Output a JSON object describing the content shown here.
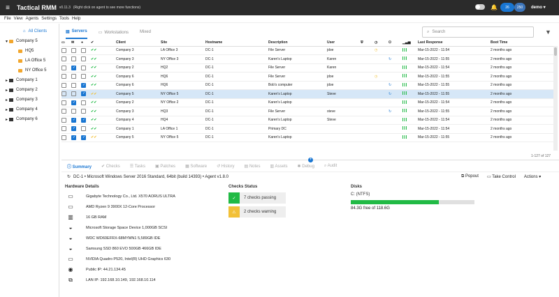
{
  "app": {
    "title": "Tactical RMM",
    "version": "v0.11.3",
    "subtitle": "(Right click on agent to see more functions)",
    "user": "demo"
  },
  "topbar": {
    "agents_online": "26",
    "agents_total": "250",
    "menu_icon": "hamburger-icon"
  },
  "menu": [
    "File",
    "View",
    "Agents",
    "Settings",
    "Tools",
    "Help"
  ],
  "sidebar": {
    "all_clients": "All Clients",
    "tree": [
      {
        "label": "Company 5",
        "type": "client",
        "expanded": true
      },
      {
        "label": "HQ5",
        "type": "site"
      },
      {
        "label": "LA Office 5",
        "type": "site"
      },
      {
        "label": "NY Office 5",
        "type": "site"
      },
      {
        "label": "Company 1",
        "type": "client"
      },
      {
        "label": "Company 2",
        "type": "client"
      },
      {
        "label": "Company 3",
        "type": "client"
      },
      {
        "label": "Company 4",
        "type": "client"
      },
      {
        "label": "Company 6",
        "type": "client"
      }
    ]
  },
  "tabs": {
    "servers": "Servers",
    "workstations": "Workstations",
    "mixed": "Mixed"
  },
  "search": {
    "placeholder": "Search"
  },
  "table": {
    "headers": [
      "Client",
      "Site",
      "Hostname",
      "Description",
      "User",
      "Last Response",
      "Boot Time"
    ],
    "rows": [
      {
        "client": "Company 3",
        "site": "LA Office 3",
        "host": "DC-1",
        "desc": "File Server",
        "user": "jdoe",
        "resp": "Mar-15-2022 - 11:54",
        "boot": "2 months ago",
        "c1": false,
        "c2": false,
        "clock": true,
        "reboot": false,
        "chk": "ok",
        "sel": false
      },
      {
        "client": "Company 3",
        "site": "NY Office 3",
        "host": "DC-1",
        "desc": "Karen's Laptop",
        "user": "Karen",
        "resp": "Mar-15-2022 - 11:55",
        "boot": "2 months ago",
        "c1": false,
        "c2": false,
        "clock": false,
        "reboot": true,
        "chk": "ok",
        "sel": false
      },
      {
        "client": "Company 2",
        "site": "HQ2",
        "host": "DC-1",
        "desc": "File Server",
        "user": "Karen",
        "resp": "Mar-15-2022 - 11:54",
        "boot": "2 months ago",
        "c1": true,
        "c2": false,
        "clock": false,
        "reboot": false,
        "chk": "ok",
        "sel": false
      },
      {
        "client": "Company 6",
        "site": "HQ6",
        "host": "DC-1",
        "desc": "File Server",
        "user": "jdoe",
        "resp": "Mar-15-2022 - 11:55",
        "boot": "2 months ago",
        "c1": false,
        "c2": false,
        "clock": true,
        "reboot": false,
        "chk": "ok",
        "sel": false
      },
      {
        "client": "Company 6",
        "site": "HQ6",
        "host": "DC-1",
        "desc": "Bob's computer",
        "user": "jdoe",
        "resp": "Mar-15-2022 - 11:55",
        "boot": "2 months ago",
        "c1": false,
        "c2": true,
        "clock": false,
        "reboot": true,
        "chk": "ok",
        "sel": false
      },
      {
        "client": "Company 5",
        "site": "NY Office 5",
        "host": "DC-1",
        "desc": "Karen's Laptop",
        "user": "Steve",
        "resp": "Mar-15-2022 - 11:55",
        "boot": "2 months ago",
        "c1": false,
        "c2": true,
        "clock": false,
        "reboot": true,
        "chk": "warn",
        "sel": true
      },
      {
        "client": "Company 2",
        "site": "NY Office 2",
        "host": "DC-1",
        "desc": "Karen's Laptop",
        "user": "",
        "resp": "Mar-15-2022 - 11:54",
        "boot": "2 months ago",
        "c1": true,
        "c2": false,
        "clock": false,
        "reboot": false,
        "chk": "ok",
        "sel": false
      },
      {
        "client": "Company 3",
        "site": "HQ3",
        "host": "DC-1",
        "desc": "File Server",
        "user": "steve",
        "resp": "Mar-15-2022 - 11:55",
        "boot": "2 months ago",
        "c1": false,
        "c2": false,
        "clock": false,
        "reboot": true,
        "chk": "ok",
        "sel": false
      },
      {
        "client": "Company 4",
        "site": "HQ4",
        "host": "DC-1",
        "desc": "Karen's Laptop",
        "user": "Steve",
        "resp": "Mar-15-2022 - 11:54",
        "boot": "2 months ago",
        "c1": true,
        "c2": true,
        "clock": false,
        "reboot": false,
        "chk": "ok",
        "sel": false
      },
      {
        "client": "Company 1",
        "site": "LA Office 1",
        "host": "DC-1",
        "desc": "Primary DC",
        "user": "",
        "resp": "Mar-15-2022 - 11:54",
        "boot": "2 months ago",
        "c1": true,
        "c2": false,
        "clock": false,
        "reboot": false,
        "chk": "ok",
        "sel": false
      },
      {
        "client": "Company 5",
        "site": "NY Office 5",
        "host": "DC-1",
        "desc": "Karen's Laptop",
        "user": "",
        "resp": "Mar-15-2022 - 11:55",
        "boot": "2 months ago",
        "c1": true,
        "c2": true,
        "clock": false,
        "reboot": false,
        "chk": "warn",
        "sel": false
      }
    ],
    "count": "1-127 of 127"
  },
  "bottom_tabs": [
    "Summary",
    "Checks",
    "Tasks",
    "Patches",
    "Software",
    "History",
    "Notes",
    "Assets",
    "Debug",
    "Audit"
  ],
  "agent_line": "DC-1 • Microsoft Windows Server 2016 Standard, 64bit (build 14393) • Agent v1.8.0",
  "actions": {
    "popout": "Popout",
    "take_control": "Take Control",
    "actions": "Actions"
  },
  "hardware": {
    "title": "Hardware Details",
    "items": [
      {
        "icon": "motherboard-icon",
        "text": "Gigabyte Technology Co., Ltd. X570 AORUS ULTRA"
      },
      {
        "icon": "cpu-icon",
        "text": "AMD Ryzen 9 3900X 12-Core Processor"
      },
      {
        "icon": "memory-icon",
        "text": "16 GB RAM"
      },
      {
        "icon": "disk-icon",
        "text": "Microsoft Storage Space Device 1,000GB SCSI"
      },
      {
        "icon": "disk-icon",
        "text": "WDC WD60EFRX-68MYMN1 5,589GB IDE"
      },
      {
        "icon": "disk-icon",
        "text": "Samsung SSD 860 EVO 500GB 466GB IDE"
      },
      {
        "icon": "gpu-icon",
        "text": "NVIDIA Quadro P520, Intel(R) UHD Graphics 630"
      },
      {
        "icon": "globe-icon",
        "text": "Public IP: 44.21.134.45"
      },
      {
        "icon": "network-icon",
        "text": "LAN IP: 192.168.10.149, 192.168.10.114"
      }
    ]
  },
  "checks": {
    "title": "Checks Status",
    "passing": "7 checks passing",
    "warning": "2 checks warning"
  },
  "disks": {
    "title": "Disks",
    "name": "C: (NTFS)",
    "used_fraction": 0.71,
    "free": "84.3G free of 118.6G"
  },
  "colors": {
    "accent": "#1976d2",
    "ok": "#21ba45",
    "warn": "#f2c037"
  }
}
